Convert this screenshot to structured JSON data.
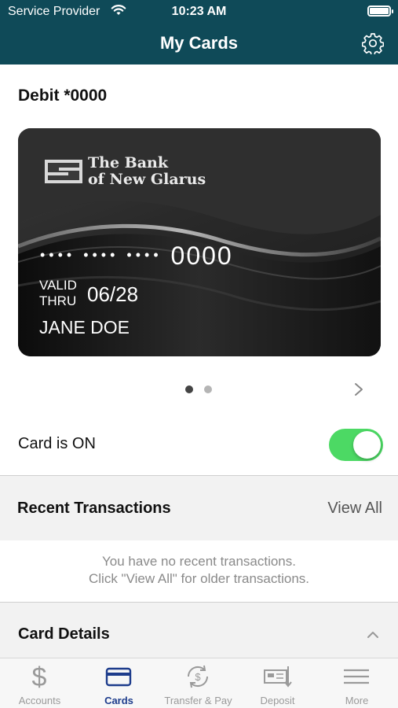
{
  "status_bar": {
    "carrier": "Service Provider",
    "time": "10:23 AM"
  },
  "header": {
    "title": "My Cards",
    "settings_icon": "gear-icon"
  },
  "card_section": {
    "title": "Debit *0000",
    "card": {
      "bank_name_line1": "The Bank",
      "bank_name_line2": "of New Glarus",
      "masked_groups": "•••• •••• ••••",
      "last4": "0000",
      "valid_label_line1": "VALID",
      "valid_label_line2": "THRU",
      "expiry": "06/28",
      "holder": "JANE DOE"
    },
    "pager": {
      "count": 2,
      "active_index": 0
    }
  },
  "card_toggle": {
    "label": "Card is ON",
    "on": true,
    "on_color": "#4cd964"
  },
  "recent_transactions": {
    "title": "Recent Transactions",
    "view_all": "View All",
    "empty_line1": "You have no recent transactions.",
    "empty_line2": "Click \"View All\" for older transactions."
  },
  "card_details": {
    "title": "Card Details",
    "expanded": true
  },
  "tabbar": {
    "active_color": "#1d3c8c",
    "tabs": [
      {
        "label": "Accounts",
        "icon": "dollar-icon"
      },
      {
        "label": "Cards",
        "icon": "card-icon"
      },
      {
        "label": "Transfer & Pay",
        "icon": "transfer-icon"
      },
      {
        "label": "Deposit",
        "icon": "check-deposit-icon"
      },
      {
        "label": "More",
        "icon": "menu-icon"
      }
    ],
    "active_index": 1
  },
  "colors": {
    "header_bg": "#0f4a58"
  }
}
